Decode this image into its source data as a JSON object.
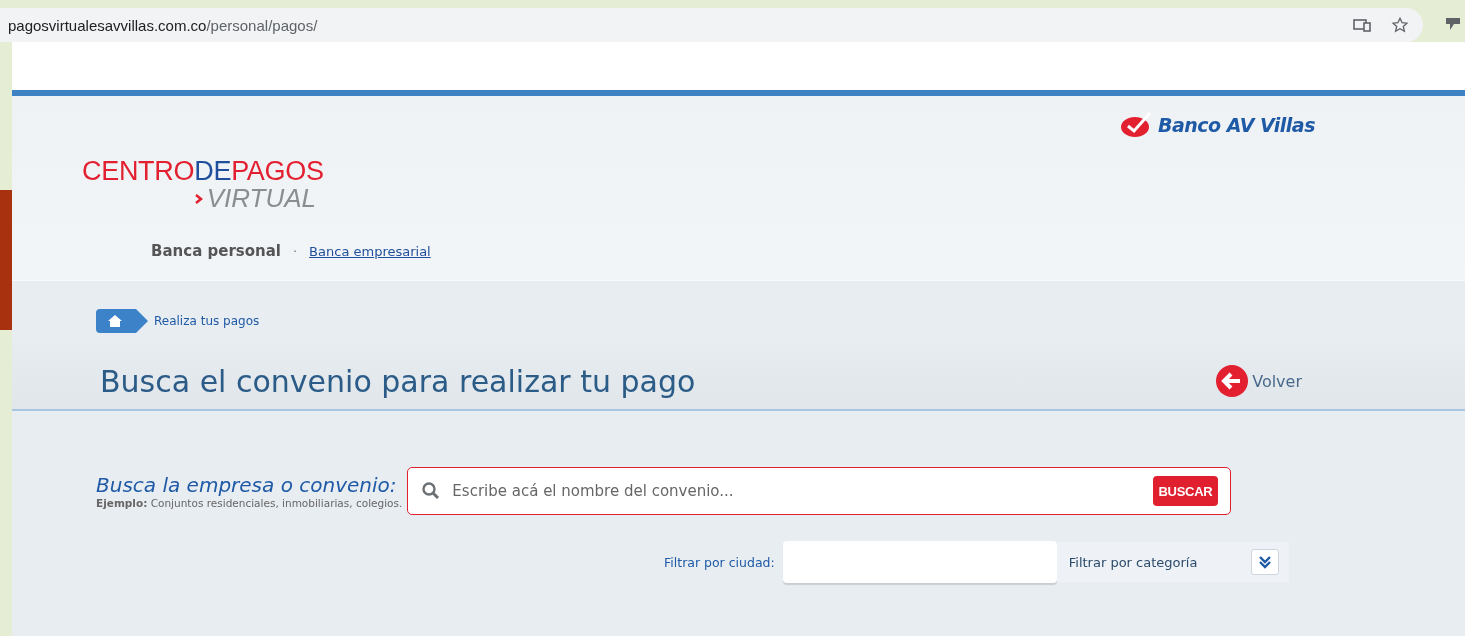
{
  "browser": {
    "url_host": "pagosvirtualesavvillas.com.co",
    "url_path": "/personal/pagos/"
  },
  "bank_logo": {
    "text": "Banco AV Villas"
  },
  "logo": {
    "parts": [
      {
        "text": "CENTRO",
        "color": "#e2202f"
      },
      {
        "text": "DE",
        "color": "#1f4f9c"
      },
      {
        "text": "PAGOS",
        "color": "#e2202f"
      }
    ],
    "sub": "VIRTUAL"
  },
  "nav_separator": "·",
  "nav": [
    {
      "label": "Banca personal",
      "selected": true
    },
    {
      "label": "Banca empresarial",
      "selected": false
    }
  ],
  "breadcrumb": {
    "label": "Realiza tus pagos"
  },
  "page_title": "Busca el convenio para realizar tu pago",
  "back": {
    "label": "Volver"
  },
  "search": {
    "label": "Busca la empresa o convenio:",
    "example": "**Ejemplo:** Conjuntos residenciales, inmobiliarias, colegios.",
    "placeholder": "Escribe acá el nombre del convenio...",
    "button": "BUSCAR"
  },
  "filters": {
    "city_label": "Filtrar por ciudad:",
    "category_label": "Filtrar por categoría"
  }
}
